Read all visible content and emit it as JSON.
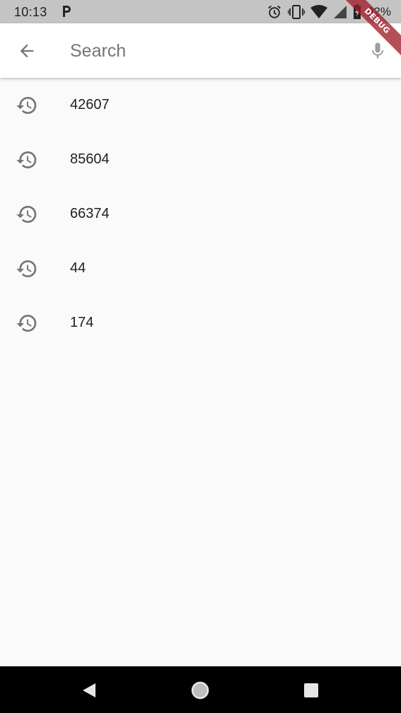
{
  "status_bar": {
    "time": "10:13",
    "battery_percent": "92%",
    "icons": [
      "parking-icon",
      "alarm-icon",
      "vibrate-icon",
      "wifi-icon",
      "signal-icon",
      "battery-icon"
    ]
  },
  "debug_banner": {
    "label": "DEBUG"
  },
  "app_bar": {
    "back_icon": "arrow-back-icon",
    "search_placeholder": "Search",
    "search_value": "",
    "mic_icon": "mic-icon"
  },
  "history": {
    "icon": "history-icon",
    "items": [
      {
        "label": "42607"
      },
      {
        "label": "85604"
      },
      {
        "label": "66374"
      },
      {
        "label": "44"
      },
      {
        "label": "174"
      }
    ]
  },
  "nav_bar": {
    "icons": [
      "nav-back-icon",
      "nav-home-icon",
      "nav-recents-icon"
    ]
  },
  "colors": {
    "status_bar_bg": "#c4c4c4",
    "app_bar_bg": "#ffffff",
    "page_bg": "#fafafa",
    "icon_grey": "#757575",
    "text_primary": "#212121",
    "nav_bar_bg": "#000000",
    "debug_red": "#a01e28"
  }
}
